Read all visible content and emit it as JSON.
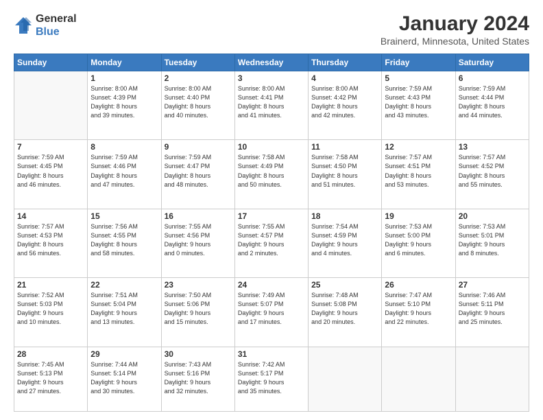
{
  "logo": {
    "line1": "General",
    "line2": "Blue"
  },
  "title": "January 2024",
  "subtitle": "Brainerd, Minnesota, United States",
  "days_of_week": [
    "Sunday",
    "Monday",
    "Tuesday",
    "Wednesday",
    "Thursday",
    "Friday",
    "Saturday"
  ],
  "weeks": [
    [
      {
        "day": "",
        "info": ""
      },
      {
        "day": "1",
        "info": "Sunrise: 8:00 AM\nSunset: 4:39 PM\nDaylight: 8 hours\nand 39 minutes."
      },
      {
        "day": "2",
        "info": "Sunrise: 8:00 AM\nSunset: 4:40 PM\nDaylight: 8 hours\nand 40 minutes."
      },
      {
        "day": "3",
        "info": "Sunrise: 8:00 AM\nSunset: 4:41 PM\nDaylight: 8 hours\nand 41 minutes."
      },
      {
        "day": "4",
        "info": "Sunrise: 8:00 AM\nSunset: 4:42 PM\nDaylight: 8 hours\nand 42 minutes."
      },
      {
        "day": "5",
        "info": "Sunrise: 7:59 AM\nSunset: 4:43 PM\nDaylight: 8 hours\nand 43 minutes."
      },
      {
        "day": "6",
        "info": "Sunrise: 7:59 AM\nSunset: 4:44 PM\nDaylight: 8 hours\nand 44 minutes."
      }
    ],
    [
      {
        "day": "7",
        "info": "Sunrise: 7:59 AM\nSunset: 4:45 PM\nDaylight: 8 hours\nand 46 minutes."
      },
      {
        "day": "8",
        "info": "Sunrise: 7:59 AM\nSunset: 4:46 PM\nDaylight: 8 hours\nand 47 minutes."
      },
      {
        "day": "9",
        "info": "Sunrise: 7:59 AM\nSunset: 4:47 PM\nDaylight: 8 hours\nand 48 minutes."
      },
      {
        "day": "10",
        "info": "Sunrise: 7:58 AM\nSunset: 4:49 PM\nDaylight: 8 hours\nand 50 minutes."
      },
      {
        "day": "11",
        "info": "Sunrise: 7:58 AM\nSunset: 4:50 PM\nDaylight: 8 hours\nand 51 minutes."
      },
      {
        "day": "12",
        "info": "Sunrise: 7:57 AM\nSunset: 4:51 PM\nDaylight: 8 hours\nand 53 minutes."
      },
      {
        "day": "13",
        "info": "Sunrise: 7:57 AM\nSunset: 4:52 PM\nDaylight: 8 hours\nand 55 minutes."
      }
    ],
    [
      {
        "day": "14",
        "info": "Sunrise: 7:57 AM\nSunset: 4:53 PM\nDaylight: 8 hours\nand 56 minutes."
      },
      {
        "day": "15",
        "info": "Sunrise: 7:56 AM\nSunset: 4:55 PM\nDaylight: 8 hours\nand 58 minutes."
      },
      {
        "day": "16",
        "info": "Sunrise: 7:55 AM\nSunset: 4:56 PM\nDaylight: 9 hours\nand 0 minutes."
      },
      {
        "day": "17",
        "info": "Sunrise: 7:55 AM\nSunset: 4:57 PM\nDaylight: 9 hours\nand 2 minutes."
      },
      {
        "day": "18",
        "info": "Sunrise: 7:54 AM\nSunset: 4:59 PM\nDaylight: 9 hours\nand 4 minutes."
      },
      {
        "day": "19",
        "info": "Sunrise: 7:53 AM\nSunset: 5:00 PM\nDaylight: 9 hours\nand 6 minutes."
      },
      {
        "day": "20",
        "info": "Sunrise: 7:53 AM\nSunset: 5:01 PM\nDaylight: 9 hours\nand 8 minutes."
      }
    ],
    [
      {
        "day": "21",
        "info": "Sunrise: 7:52 AM\nSunset: 5:03 PM\nDaylight: 9 hours\nand 10 minutes."
      },
      {
        "day": "22",
        "info": "Sunrise: 7:51 AM\nSunset: 5:04 PM\nDaylight: 9 hours\nand 13 minutes."
      },
      {
        "day": "23",
        "info": "Sunrise: 7:50 AM\nSunset: 5:06 PM\nDaylight: 9 hours\nand 15 minutes."
      },
      {
        "day": "24",
        "info": "Sunrise: 7:49 AM\nSunset: 5:07 PM\nDaylight: 9 hours\nand 17 minutes."
      },
      {
        "day": "25",
        "info": "Sunrise: 7:48 AM\nSunset: 5:08 PM\nDaylight: 9 hours\nand 20 minutes."
      },
      {
        "day": "26",
        "info": "Sunrise: 7:47 AM\nSunset: 5:10 PM\nDaylight: 9 hours\nand 22 minutes."
      },
      {
        "day": "27",
        "info": "Sunrise: 7:46 AM\nSunset: 5:11 PM\nDaylight: 9 hours\nand 25 minutes."
      }
    ],
    [
      {
        "day": "28",
        "info": "Sunrise: 7:45 AM\nSunset: 5:13 PM\nDaylight: 9 hours\nand 27 minutes."
      },
      {
        "day": "29",
        "info": "Sunrise: 7:44 AM\nSunset: 5:14 PM\nDaylight: 9 hours\nand 30 minutes."
      },
      {
        "day": "30",
        "info": "Sunrise: 7:43 AM\nSunset: 5:16 PM\nDaylight: 9 hours\nand 32 minutes."
      },
      {
        "day": "31",
        "info": "Sunrise: 7:42 AM\nSunset: 5:17 PM\nDaylight: 9 hours\nand 35 minutes."
      },
      {
        "day": "",
        "info": ""
      },
      {
        "day": "",
        "info": ""
      },
      {
        "day": "",
        "info": ""
      }
    ]
  ]
}
